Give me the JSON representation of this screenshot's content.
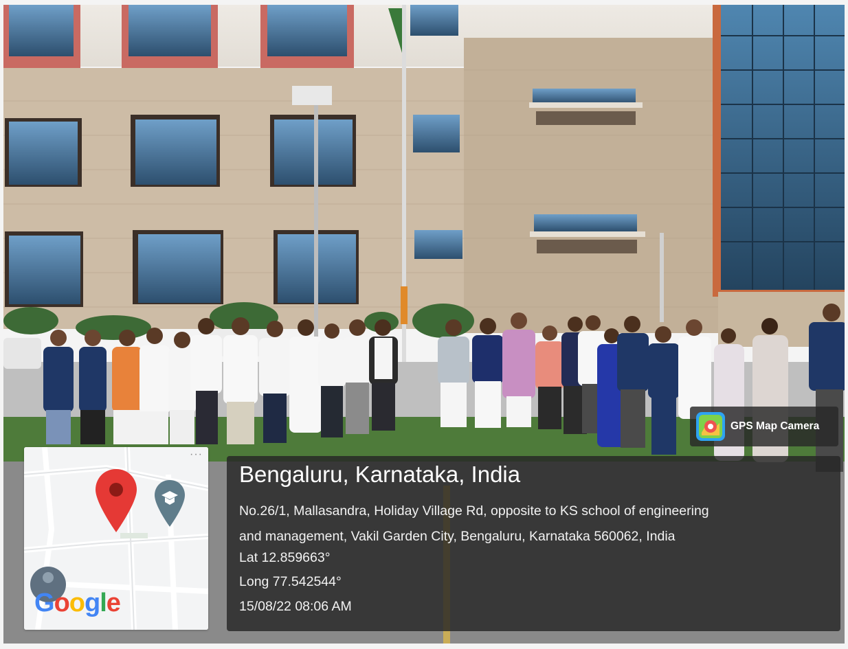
{
  "photo": {
    "description_icon": "photo-scene"
  },
  "map": {
    "logo": {
      "G": "G",
      "o1": "o",
      "o2": "o",
      "g": "g",
      "l": "l",
      "e": "e"
    },
    "menu_icon": "more-dots-icon",
    "pin_icon": "map-pin-icon",
    "school_icon": "school-marker-icon",
    "colors": {
      "pin": "#E53935",
      "school_marker": "#607D8B"
    }
  },
  "badge": {
    "label": "GPS Map Camera",
    "icon": "gps-map-camera-app-icon"
  },
  "location": {
    "title": "Bengaluru, Karnataka, India",
    "address_line1": "No.26/1, Mallasandra, Holiday Village Rd, opposite to KS school of engineering",
    "address_line2": "and management, Vakil Garden City, Bengaluru, Karnataka 560062, India",
    "lat": "Lat 12.859663°",
    "long": "Long 77.542544°",
    "datetime": "15/08/22 08:06 AM"
  }
}
